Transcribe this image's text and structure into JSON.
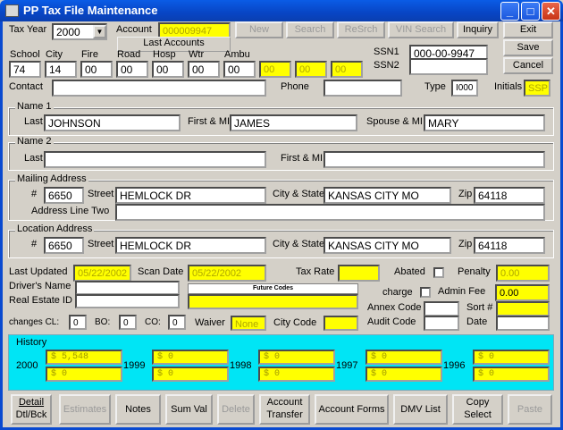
{
  "window": {
    "title": "PP Tax File Maintenance",
    "min": "_",
    "max": "□",
    "close": "✕"
  },
  "top": {
    "tax_year_label": "Tax Year",
    "tax_year": "2000",
    "account_label": "Account",
    "account": "000009947",
    "last_accounts": "Last Accounts",
    "new": "New",
    "search": "Search",
    "resrch": "ReSrch",
    "vin_search": "VIN Search",
    "inquiry": "Inquiry",
    "exit": "Exit",
    "save": "Save",
    "cancel": "Cancel"
  },
  "codes": {
    "school_label": "School",
    "school": "74",
    "city_label": "City",
    "city": "14",
    "fire_label": "Fire",
    "fire": "00",
    "road_label": "Road",
    "road": "00",
    "hosp_label": "Hosp",
    "hosp": "00",
    "wtr_label": "Wtr",
    "wtr": "00",
    "ambu_label": "Ambu",
    "ambu": "00",
    "extra1": "00",
    "extra2": "00",
    "extra3": "00"
  },
  "ssn": {
    "ssn1_label": "SSN1",
    "ssn1": "000-00-9947",
    "ssn2_label": "SSN2",
    "ssn2": ""
  },
  "contact": {
    "contact_label": "Contact",
    "contact": "",
    "phone_label": "Phone",
    "phone": "",
    "type_label": "Type",
    "type": "I000",
    "initials_label": "Initials",
    "initials": "SSP"
  },
  "name1": {
    "legend": "Name 1",
    "last_label": "Last",
    "last": "JOHNSON",
    "first_label": "First & MI",
    "first": "JAMES",
    "spouse_label": "Spouse & MI",
    "spouse": "MARY"
  },
  "name2": {
    "legend": "Name 2",
    "last_label": "Last",
    "last": "",
    "first_label": "First & MI",
    "first": ""
  },
  "mailing": {
    "legend": "Mailing Address",
    "num_label": "#",
    "num": "6650",
    "street_label": "Street",
    "street": "HEMLOCK DR",
    "citystate_label": "City & State",
    "citystate": "KANSAS CITY MO",
    "zip_label": "Zip",
    "zip": "64118",
    "line2_label": "Address Line Two",
    "line2": ""
  },
  "location": {
    "legend": "Location Address",
    "num_label": "#",
    "num": "6650",
    "street_label": "Street",
    "street": "HEMLOCK DR",
    "citystate_label": "City & State",
    "citystate": "KANSAS CITY MO",
    "zip_label": "Zip",
    "zip": "64118"
  },
  "info": {
    "last_updated_label": "Last Updated",
    "last_updated": "05/22/2002",
    "scan_date_label": "Scan Date",
    "scan_date": "05/22/2002",
    "tax_rate_label": "Tax Rate",
    "tax_rate": "",
    "abated_label": "Abated",
    "penalty_label": "Penalty",
    "penalty": "0.00",
    "drivers_label": "Driver's Name",
    "realestate_label": "Real Estate ID",
    "future_codes": "Future Codes",
    "charge_label": "charge",
    "admin_fee_label": "Admin Fee",
    "admin_fee": "0.00",
    "annex_label": "Annex Code",
    "audit_label": "Audit Code",
    "sort_label": "Sort #",
    "date_label": "Date",
    "changes_cl_label": "changes CL:",
    "changes_cl": "0",
    "bo_label": "BO:",
    "bo": "0",
    "co_label": "CO:",
    "co": "0",
    "waiver_label": "Waiver",
    "waiver": "None",
    "city_code_label": "City Code"
  },
  "history": {
    "legend": "History",
    "years": [
      {
        "year": "2000",
        "v1": "$ 5,548",
        "v2": "$ 0"
      },
      {
        "year": "1999",
        "v1": "$ 0",
        "v2": "$ 0"
      },
      {
        "year": "1998",
        "v1": "$ 0",
        "v2": "$ 0"
      },
      {
        "year": "1997",
        "v1": "$ 0",
        "v2": "$ 0"
      },
      {
        "year": "1996",
        "v1": "$ 0",
        "v2": "$ 0"
      }
    ]
  },
  "bottom": {
    "detail": "Detail",
    "dtlbck": "Dtl/Bck",
    "estimates": "Estimates",
    "notes": "Notes",
    "sumval": "Sum Val",
    "delete": "Delete",
    "acct_transfer1": "Account",
    "acct_transfer2": "Transfer",
    "acct_forms": "Account Forms",
    "dmv_list": "DMV List",
    "copy_select1": "Copy",
    "copy_select2": "Select",
    "paste": "Paste"
  }
}
